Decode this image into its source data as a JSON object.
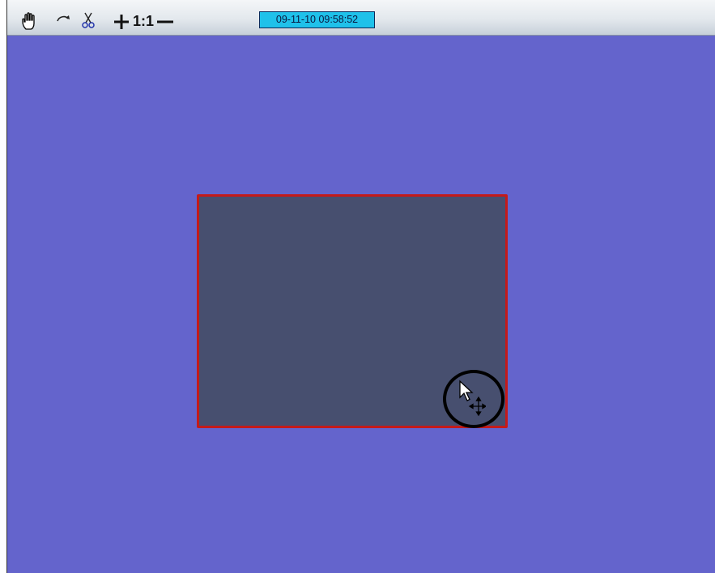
{
  "toolbar": {
    "icons": {
      "hand": "hand-pan-icon",
      "rotate": "rotate-icon",
      "scissors": "scissors-icon",
      "zoom_in": "plus-icon",
      "zoom_out": "minus-icon"
    },
    "zoom_ratio": "1:1",
    "timestamp": "09-11-10   09:58:52"
  },
  "viewport": {
    "background_color": "#6464cc",
    "zone_fill_color": "#474f6f",
    "zone_border_color": "#c41a1a",
    "highlight_color": "#000000",
    "cursor": "move-cursor-icon"
  }
}
